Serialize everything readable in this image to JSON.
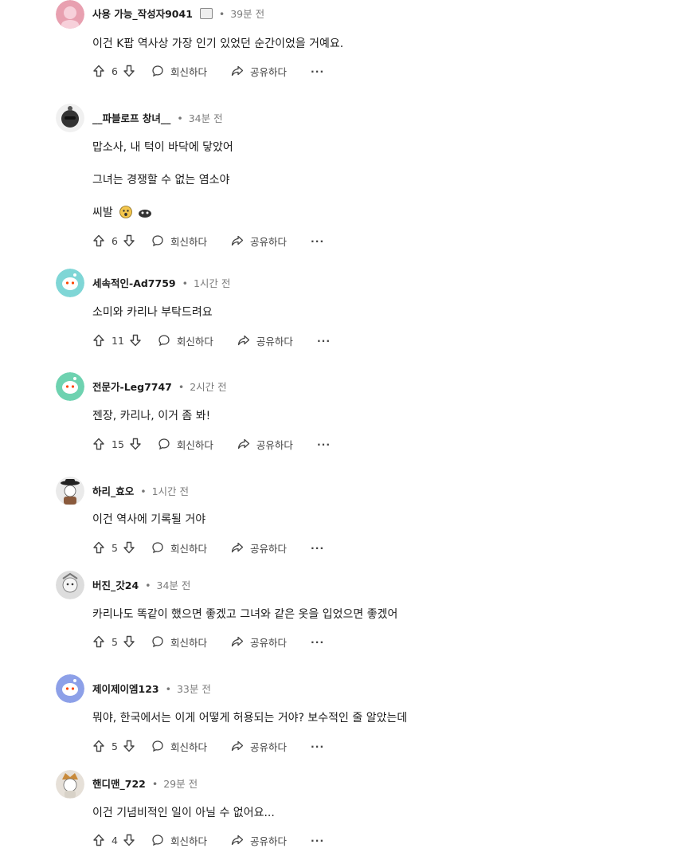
{
  "ui": {
    "reply_label": "회신하다",
    "share_label": "공유하다",
    "more_label": "···",
    "separator": "•"
  },
  "comments": [
    {
      "author": "사용 가능_작성자9041",
      "time": "39분 전",
      "lines": [
        "이건 K팝 역사상 가장 인기 있었던 순간이었을 거예요."
      ],
      "votes": "6",
      "avatar_color": "#e8a0b0"
    },
    {
      "author": "__파블로프 창녀__",
      "time": "34분 전",
      "lines": [
        "맙소사, 내 턱이 바닥에 닿았어",
        "그녀는 경쟁할 수 없는 염소야",
        "씨발"
      ],
      "votes": "6",
      "avatar_color": "#333333"
    },
    {
      "author": "세속적인-Ad7759",
      "time": "1시간 전",
      "lines": [
        "소미와 카리나 부탁드려요"
      ],
      "votes": "11",
      "avatar_color": "#7fd6d6"
    },
    {
      "author": "전문가-Leg7747",
      "time": "2시간 전",
      "lines": [
        "젠장, 카리나, 이거 좀 봐!"
      ],
      "votes": "15",
      "avatar_color": "#6ed2b0"
    },
    {
      "author": "하리_효오",
      "time": "1시간 전",
      "lines": [
        "이건 역사에 기록될 거야"
      ],
      "votes": "5",
      "avatar_color": "#eaeaea"
    },
    {
      "author": "버진_갓24",
      "time": "34분 전",
      "lines": [
        "카리나도 똑같이 했으면 좋겠고 그녀와 같은 옷을 입었으면 좋겠어"
      ],
      "votes": "5",
      "avatar_color": "#dddddd"
    },
    {
      "author": "제이제이엠123",
      "time": "33분 전",
      "lines": [
        "뭐야, 한국에서는 이게 어떻게 허용되는 거야? 보수적인 줄 알았는데"
      ],
      "votes": "5",
      "avatar_color": "#8da0e8"
    },
    {
      "author": "핸디맨_722",
      "time": "29분 전",
      "lines": [
        "이건 기념비적인 일이 아닐 수 없어요..."
      ],
      "votes": "4",
      "avatar_color": "#e6e0d8"
    }
  ]
}
